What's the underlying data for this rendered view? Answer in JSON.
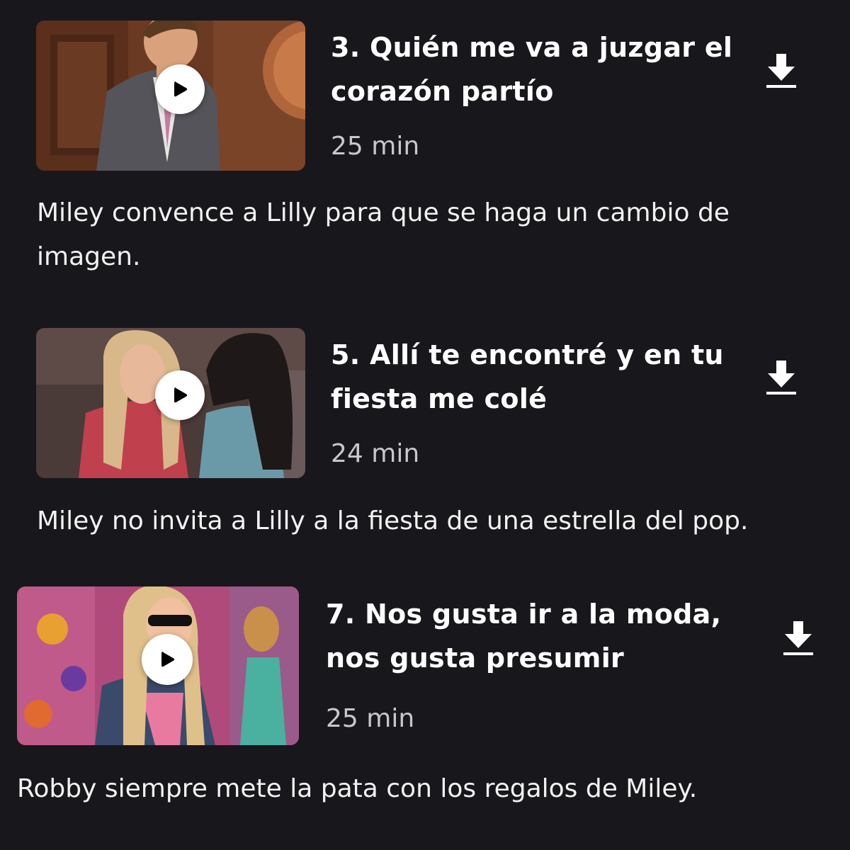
{
  "episodes": [
    {
      "title": "3. Quién me va a juzgar el corazón partío",
      "duration": "25 min",
      "description": "Miley convence a Lilly para que se haga un cambio de imagen.",
      "play_icon": "play-icon",
      "download_icon": "download-icon"
    },
    {
      "title": "5. Allí te encontré y en tu fiesta me colé",
      "duration": "24 min",
      "description": "Miley no invita a Lilly a la fiesta de una estrella del pop.",
      "play_icon": "play-icon",
      "download_icon": "download-icon"
    },
    {
      "title": "7. Nos gusta ir a la moda, nos gusta presumir",
      "duration": "25 min",
      "description": "Robby siempre mete la pata con los regalos de Miley.",
      "play_icon": "play-icon",
      "download_icon": "download-icon"
    }
  ],
  "colors": {
    "background": "#18171c",
    "text_primary": "#ffffff",
    "text_secondary": "#c8c8cc"
  }
}
